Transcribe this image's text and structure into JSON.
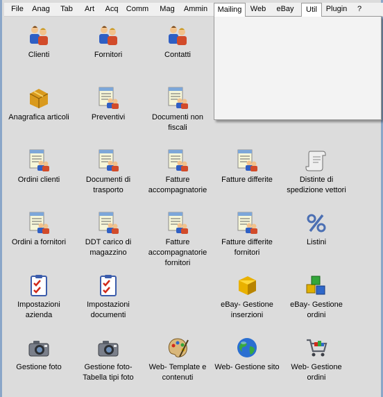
{
  "menu": {
    "items": [
      "File",
      "Anag",
      "Tab",
      "Art",
      "Acq",
      "Comm",
      "Mag",
      "Ammin",
      "Mailing",
      "Web",
      "eBay",
      "Util",
      "Plugin",
      "?"
    ],
    "open_item": "Util"
  },
  "tiles": [
    {
      "name": "clienti",
      "label": "Clienti",
      "icon": "people-icon"
    },
    {
      "name": "fornitori",
      "label": "Fornitori",
      "icon": "people-icon"
    },
    {
      "name": "contatti",
      "label": "Contatti",
      "icon": "people-icon"
    },
    {
      "name": "anagrafica-articoli",
      "label": "Anagrafica articoli",
      "icon": "boxes-icon"
    },
    {
      "name": "preventivi",
      "label": "Preventivi",
      "icon": "document-people-icon"
    },
    {
      "name": "documenti-non-fiscali",
      "label": "Documenti non fiscali",
      "icon": "document-people-icon"
    },
    {
      "name": "ordini-clienti",
      "label": "Ordini clienti",
      "icon": "document-people-icon"
    },
    {
      "name": "documenti-di-trasporto",
      "label": "Documenti di trasporto",
      "icon": "document-people-icon"
    },
    {
      "name": "fatture-accompagnatorie",
      "label": "Fatture accompagnatorie",
      "icon": "document-people-icon"
    },
    {
      "name": "fatture-differite",
      "label": "Fatture differite",
      "icon": "document-people-icon"
    },
    {
      "name": "distinte-di-spedizione-vettori",
      "label": "Distinte di spedizione vettori",
      "icon": "scroll-icon"
    },
    {
      "name": "ordini-a-fornitori",
      "label": "Ordini a fornitori",
      "icon": "document-people-icon"
    },
    {
      "name": "ddt-carico-di-magazzino",
      "label": "DDT carico di magazzino",
      "icon": "document-people-icon"
    },
    {
      "name": "fatture-accompagnatorie-fornitori",
      "label": "Fatture accompagnatorie fornitori",
      "icon": "document-people-icon"
    },
    {
      "name": "fatture-differite-fornitori",
      "label": "Fatture differite fornitori",
      "icon": "document-people-icon"
    },
    {
      "name": "listini",
      "label": "Listini",
      "icon": "percent-icon"
    },
    {
      "name": "impostazioni-azienda",
      "label": "Impostazioni azienda",
      "icon": "checklist-icon"
    },
    {
      "name": "impostazioni-documenti",
      "label": "Impostazioni documenti",
      "icon": "checklist-icon"
    },
    {
      "name": "ebay-gestione-inserzioni",
      "label": "eBay- Gestione inserzioni",
      "icon": "cube-icon"
    },
    {
      "name": "ebay-gestione-ordini",
      "label": "eBay- Gestione ordini",
      "icon": "cubes-icon"
    },
    {
      "name": "gestione-foto",
      "label": "Gestione foto",
      "icon": "camera-icon"
    },
    {
      "name": "gestione-foto-tabella-tipi-foto",
      "label": "Gestione foto- Tabella tipi foto",
      "icon": "camera-icon"
    },
    {
      "name": "web-template-e-contenuti",
      "label": "Web- Template e contenuti",
      "icon": "palette-icon"
    },
    {
      "name": "web-gestione-sito",
      "label": "Web- Gestione sito",
      "icon": "globe-icon"
    },
    {
      "name": "web-gestione-ordini",
      "label": "Web- Gestione ordini",
      "icon": "cart-icon"
    }
  ]
}
